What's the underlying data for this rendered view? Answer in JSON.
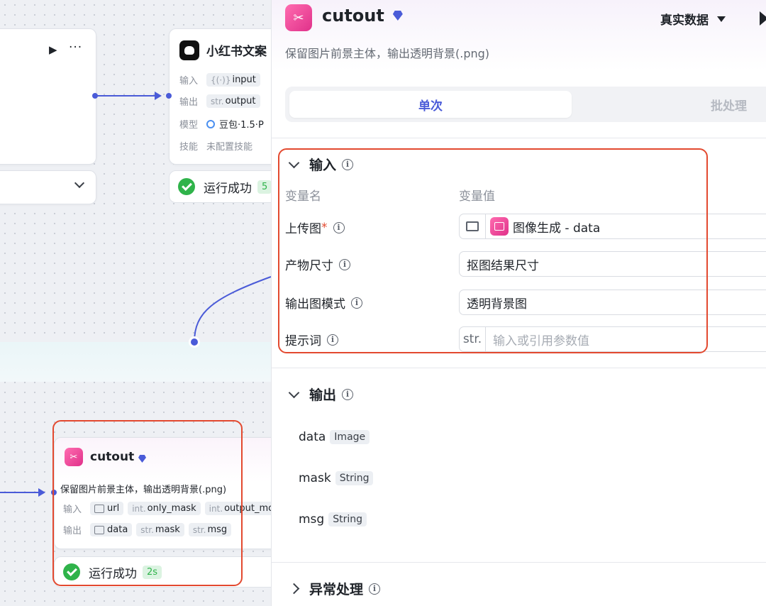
{
  "top_node": {
    "title": "小红书文案",
    "rows": [
      {
        "label": "输入",
        "tags": [
          {
            "prefix": "{(·)}",
            "text": "input"
          }
        ]
      },
      {
        "label": "输出",
        "tags": [
          {
            "prefix": "str.",
            "text": "output"
          }
        ]
      },
      {
        "label": "模型",
        "model": "豆包·1.5·P"
      },
      {
        "label": "技能",
        "value": "未配置技能"
      }
    ],
    "status": "运行成功",
    "duration": "5"
  },
  "cutout_node": {
    "title": "cutout",
    "description": "保留图片前景主体，输出透明背景(.png)",
    "input_label": "输入",
    "inputs": [
      {
        "prefix": "",
        "text": "url",
        "icon": "image-icon"
      },
      {
        "prefix": "int.",
        "text": "only_mask"
      },
      {
        "prefix": "int.",
        "text": "output_mod"
      }
    ],
    "output_label": "输出",
    "outputs": [
      {
        "prefix": "",
        "text": "data",
        "icon": "image-icon"
      },
      {
        "prefix": "str.",
        "text": "mask"
      },
      {
        "prefix": "str.",
        "text": "msg"
      }
    ],
    "status": "运行成功",
    "duration": "2s"
  },
  "panel": {
    "title": "cutout",
    "description": "保留图片前景主体，输出透明背景(.png)",
    "data_mode": "真实数据",
    "tabs": [
      {
        "label": "单次",
        "active": true
      },
      {
        "label": "批处理",
        "active": false
      }
    ],
    "input_section": {
      "title": "输入",
      "col_name": "变量名",
      "col_value": "变量值",
      "params": [
        {
          "label": "上传图",
          "required": "*",
          "value_source": "图像生成 - data"
        },
        {
          "label": "产物尺寸",
          "value": "抠图结果尺寸"
        },
        {
          "label": "输出图模式",
          "value": "透明背景图"
        },
        {
          "label": "提示词",
          "type_prefix": "str.",
          "placeholder": "输入或引用参数值"
        }
      ]
    },
    "output_section": {
      "title": "输出",
      "outputs": [
        {
          "name": "data",
          "type": "Image"
        },
        {
          "name": "mask",
          "type": "String"
        },
        {
          "name": "msg",
          "type": "String"
        }
      ]
    },
    "error_section": {
      "title": "异常处理"
    }
  },
  "colors": {
    "accent": "#4a5bd8",
    "success": "#2fb34a",
    "highlight": "#e3492f",
    "app_icon": "#e0318a"
  }
}
